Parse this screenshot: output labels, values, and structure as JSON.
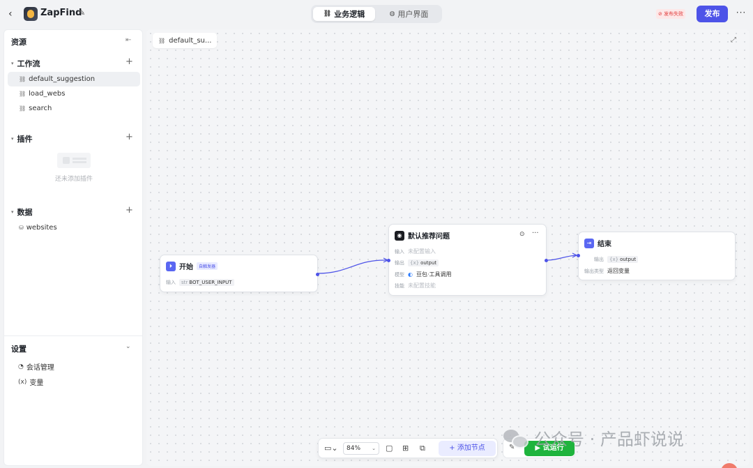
{
  "header": {
    "app_name": "ZapFind",
    "tabs": [
      {
        "label": "业务逻辑",
        "active": true
      },
      {
        "label": "用户界面",
        "active": false
      }
    ],
    "publish_status": "发布失败",
    "publish_label": "发布",
    "more_label": "···"
  },
  "sidebar": {
    "title": "资源",
    "workflow": {
      "title": "工作流",
      "items": [
        "default_suggestion",
        "load_webs",
        "search"
      ]
    },
    "plugins": {
      "title": "插件",
      "empty_text": "还未添加插件"
    },
    "data": {
      "title": "数据",
      "items": [
        "websites"
      ]
    },
    "settings": {
      "title": "设置",
      "items": [
        "会话管理",
        "变量"
      ]
    }
  },
  "canvas": {
    "tab_label": "default_su...",
    "nodes": {
      "start": {
        "title": "开始",
        "badge": "自触发器",
        "input_key": "输入",
        "input_type": "str",
        "input_value": "BOT_USER_INPUT"
      },
      "suggest": {
        "title": "默认推荐问题",
        "rows": [
          {
            "key": "输入",
            "value": "未配置输入"
          },
          {
            "key": "输出",
            "type": "{x}",
            "value": "output"
          },
          {
            "key": "模型",
            "value": "豆包·工具调用"
          },
          {
            "key": "技能",
            "value": "未配置技能"
          }
        ]
      },
      "end": {
        "title": "结束",
        "output_key": "输出",
        "output_type": "{x}",
        "output_value": "output",
        "output_kind_key": "输出类型",
        "output_kind_value": "返回变量"
      }
    }
  },
  "toolbar": {
    "zoom": "84%",
    "add_node_label": "添加节点",
    "run_label": "试运行"
  },
  "watermark": "公众号 · 产品虾说说",
  "colors": {
    "accent": "#4d53e8",
    "run_green": "#1fb43d",
    "error": "#e13b3b"
  }
}
